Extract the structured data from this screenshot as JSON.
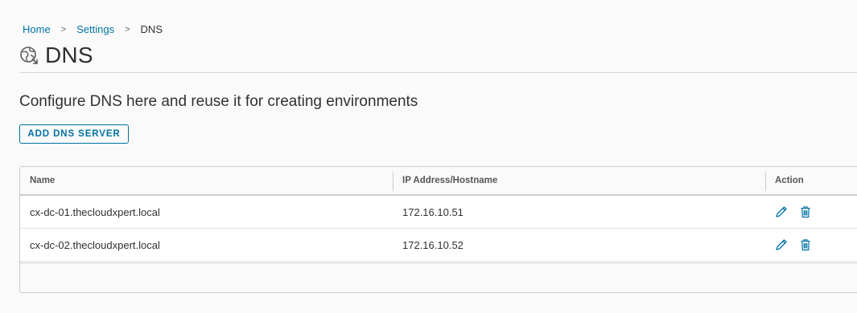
{
  "breadcrumb": {
    "items": [
      "Home",
      "Settings"
    ],
    "separator": ">",
    "current": "DNS"
  },
  "page": {
    "title": "DNS",
    "icon": "dns-globe-icon",
    "subtitle": "Configure DNS here and reuse it for creating environments"
  },
  "toolbar": {
    "add_label": "ADD DNS SERVER"
  },
  "table": {
    "columns": [
      "Name",
      "IP Address/Hostname",
      "Action"
    ],
    "rows": [
      {
        "name": "cx-dc-01.thecloudxpert.local",
        "ip": "172.16.10.51"
      },
      {
        "name": "cx-dc-02.thecloudxpert.local",
        "ip": "172.16.10.52"
      }
    ],
    "action_icons": [
      "pencil-icon",
      "trash-icon"
    ]
  },
  "colors": {
    "accent": "#0072a3",
    "text": "#313131",
    "border": "#cccccc"
  }
}
